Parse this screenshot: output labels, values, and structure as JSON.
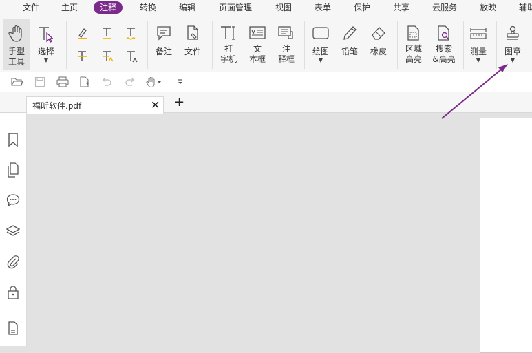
{
  "menu": [
    "文件",
    "主页",
    "注释",
    "转换",
    "编辑",
    "页面管理",
    "视图",
    "表单",
    "保护",
    "共享",
    "云服务",
    "放映",
    "辅助"
  ],
  "menu_active": "注释",
  "accent_color": "#7b2a8c",
  "ribbon": {
    "hand_tool": "手型\n工具",
    "select": "选择",
    "note": "备注",
    "file": "文件",
    "typewriter": "打\n字机",
    "textbox": "文\n本框",
    "callout": "注\n释框",
    "drawing": "绘图",
    "pencil": "铅笔",
    "eraser": "橡皮",
    "area_highlight": "区域\n高亮",
    "search_highlight": "搜索\n&高亮",
    "measure": "测量",
    "stamp": "图章"
  },
  "document_tab": {
    "title": "福昕软件.pdf",
    "close": "✕",
    "add": "+"
  },
  "icons": {
    "quick_access": [
      "folder-open-icon",
      "save-icon",
      "print-icon",
      "new-document-icon",
      "undo-icon",
      "redo-icon",
      "hand-icon",
      "customize-icon"
    ],
    "left_panel": [
      "bookmark-icon",
      "pages-icon",
      "comment-icon",
      "layers-icon",
      "attachment-icon",
      "security-icon",
      "document-icon"
    ]
  }
}
